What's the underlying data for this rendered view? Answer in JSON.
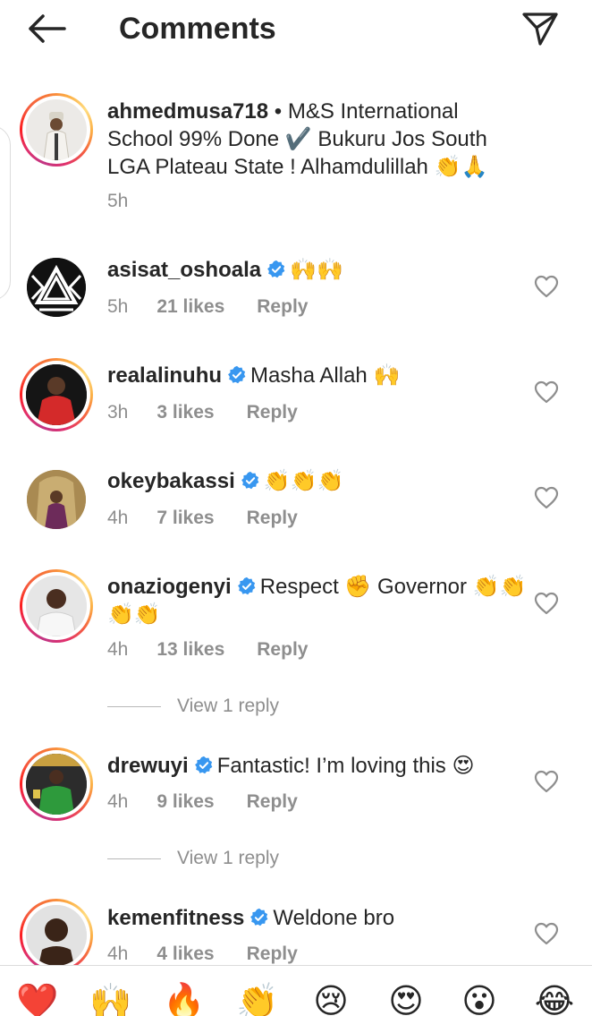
{
  "header": {
    "title": "Comments",
    "back_icon": "arrow-left-icon",
    "share_icon": "paper-plane-icon"
  },
  "comments": [
    {
      "username": "ahmedmusa718",
      "verified": false,
      "text": " • M&S International School 99% Done ✔️ Bukuru Jos South LGA Plateau State ! Alhamdulillah 👏🙏",
      "time": "5h",
      "likes": "",
      "reply_label": "",
      "story_ring": true
    },
    {
      "username": "asisat_oshoala",
      "verified": true,
      "text": "🙌🙌",
      "time": "5h",
      "likes": "21 likes",
      "reply_label": "Reply",
      "story_ring": false
    },
    {
      "username": "realalinuhu",
      "verified": true,
      "text": "Masha Allah 🙌",
      "time": "3h",
      "likes": "3 likes",
      "reply_label": "Reply",
      "story_ring": true
    },
    {
      "username": "okeybakassi",
      "verified": true,
      "text": "👏👏👏",
      "time": "4h",
      "likes": "7 likes",
      "reply_label": "Reply",
      "story_ring": false
    },
    {
      "username": "onaziogenyi",
      "verified": true,
      "text": "Respect ✊ Governor 👏👏👏👏",
      "time": "4h",
      "likes": "13 likes",
      "reply_label": "Reply",
      "story_ring": true,
      "view_replies": "View 1 reply"
    },
    {
      "username": "drewuyi",
      "verified": true,
      "text": "Fantastic! I’m loving this 😍",
      "time": "4h",
      "likes": "9 likes",
      "reply_label": "Reply",
      "story_ring": true,
      "view_replies": "View 1 reply"
    },
    {
      "username": "kemenfitness",
      "verified": true,
      "text": "Weldone bro",
      "time": "4h",
      "likes": "4 likes",
      "reply_label": "Reply",
      "story_ring": true
    }
  ],
  "emoji_bar": [
    "❤️",
    "🙌",
    "🔥",
    "👏",
    "😢",
    "😍",
    "😮",
    "😂"
  ],
  "colors": {
    "verified_blue": "#3897f0",
    "text": "#262626",
    "secondary": "#8e8e8e"
  }
}
